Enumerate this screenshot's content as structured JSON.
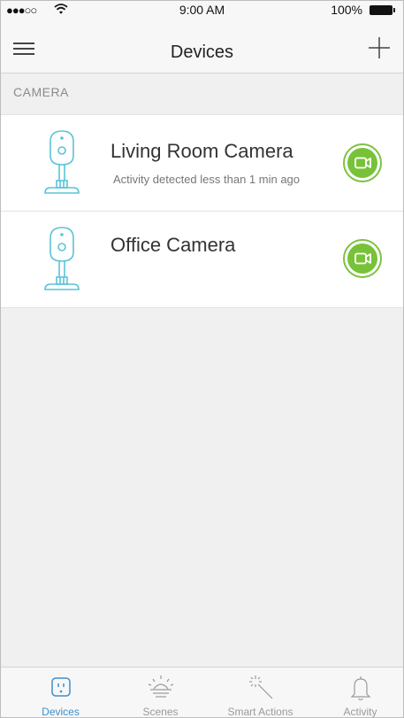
{
  "status_bar": {
    "signal": "●●●○○",
    "time": "9:00 AM",
    "battery": "100%"
  },
  "header": {
    "title": "Devices",
    "menu_icon": "hamburger-menu-icon",
    "add_icon": "plus-icon"
  },
  "section": {
    "label": "CAMERA"
  },
  "devices": [
    {
      "name": "Living Room Camera",
      "status": "Activity detected less than 1 min ago",
      "icon": "camera-device-icon",
      "action_icon": "video-camera-icon"
    },
    {
      "name": "Office Camera",
      "status": "",
      "icon": "camera-device-icon",
      "action_icon": "video-camera-icon"
    }
  ],
  "tabs": [
    {
      "label": "Devices",
      "icon": "outlet-icon",
      "active": true
    },
    {
      "label": "Scenes",
      "icon": "sunrise-icon",
      "active": false
    },
    {
      "label": "Smart Actions",
      "icon": "magic-wand-icon",
      "active": false
    },
    {
      "label": "Activity",
      "icon": "bell-icon",
      "active": false
    }
  ],
  "colors": {
    "accent_green": "#78c23a",
    "camera_blue": "#5ac3d8",
    "tab_active": "#3e8fcb"
  }
}
